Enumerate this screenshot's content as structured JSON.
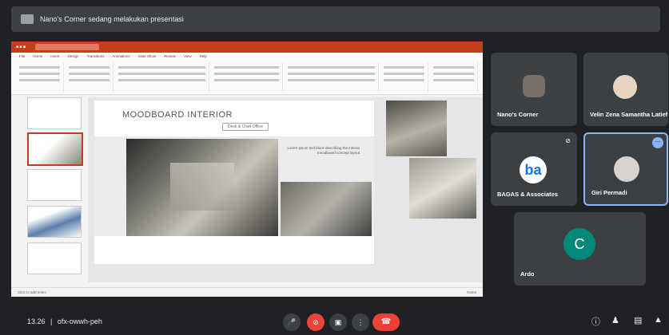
{
  "presentation_bar": {
    "text": "Nano's Corner sedang melakukan presentasi"
  },
  "ppt": {
    "tabs": [
      "File",
      "Home",
      "Insert",
      "Design",
      "Transitions",
      "Animations",
      "Slide Show",
      "Review",
      "View",
      "Help"
    ],
    "slide_title": "MOODBOARD INTERIOR",
    "slide_subtitle": "Desk & Chair Office",
    "slide_text": "Lorem ipsum text block describing the interior moodboard concept layout",
    "notes_placeholder": "Click to add notes",
    "zoom_label": "Notes"
  },
  "participants": [
    {
      "name": "Nano's Corner"
    },
    {
      "name": "Velin Zena Samantha Latief"
    },
    {
      "name": "BAGAS & Associates"
    },
    {
      "name": "Giri Permadi"
    },
    {
      "name": "Ardo",
      "initial": "C"
    }
  ],
  "meeting": {
    "time": "13.26",
    "code": "ofx-owwh-peh"
  },
  "colors": {
    "end_call": "#ea4335",
    "active_border": "#8ab4f8",
    "ppt_accent": "#c43e1c",
    "avatar_c": "#00897b",
    "logo_blue": "#1a73e8"
  }
}
